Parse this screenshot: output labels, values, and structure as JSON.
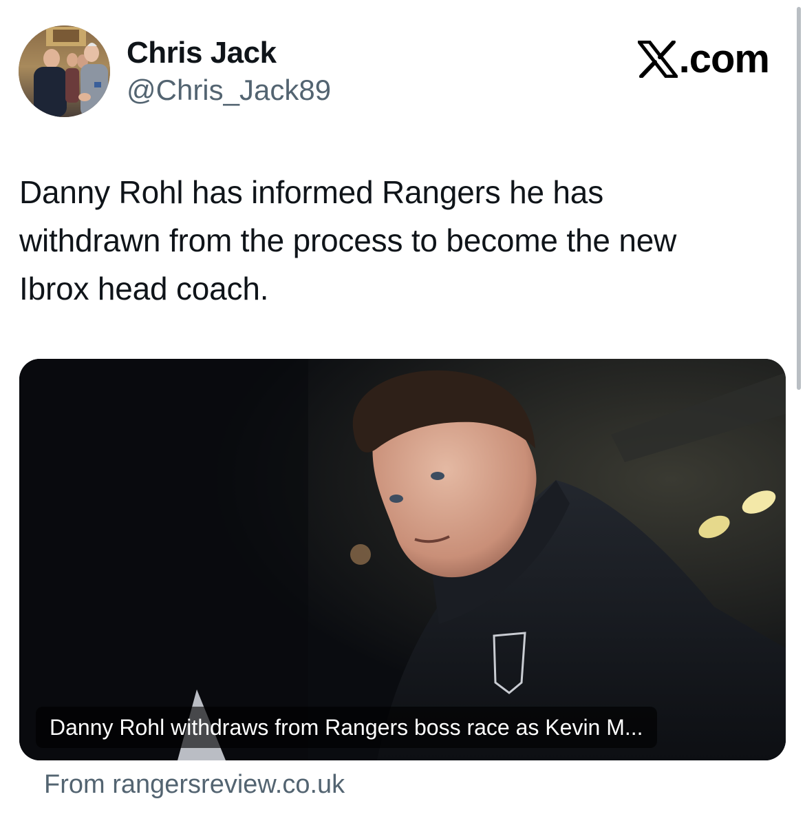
{
  "author": {
    "name": "Chris Jack",
    "handle": "@Chris_Jack89",
    "avatar_icon": "profile-photo"
  },
  "brand": {
    "icon": "x-logo-icon",
    "label": ".com"
  },
  "tweet": {
    "lines": [
      "Danny Rohl has informed Rangers he has",
      "withdrawn from the process to become the new",
      "Ibrox head coach."
    ]
  },
  "link_card": {
    "image_icon": "article-photo",
    "caption": "Danny Rohl withdraws from Rangers boss race as Kevin M...",
    "source": "From rangersreview.co.uk"
  },
  "colors": {
    "text_primary": "#0f1419",
    "text_secondary": "#536471",
    "background": "#ffffff",
    "card_background": "#0b0d12"
  }
}
